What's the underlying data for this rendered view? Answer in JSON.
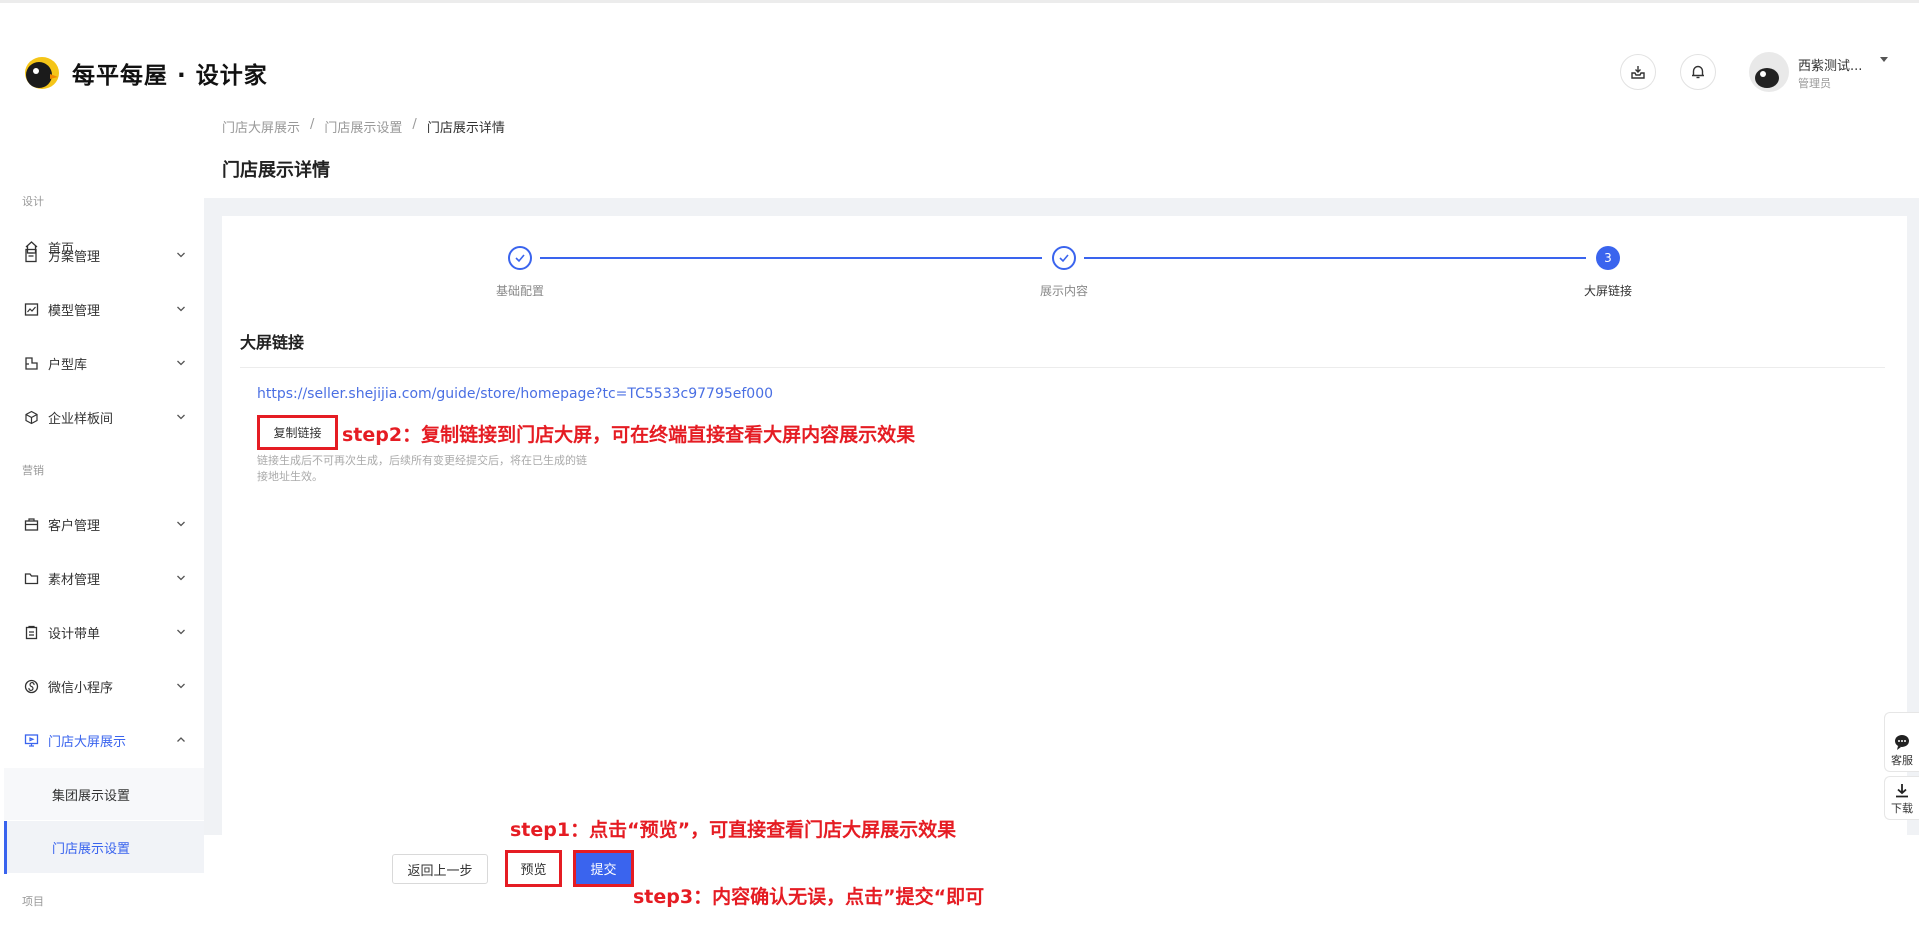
{
  "brand": {
    "name": "每平每屋 · 设计家"
  },
  "header": {
    "user_name": "西紫测试...",
    "user_role": "管理员"
  },
  "sidebar": {
    "home": "首页",
    "group_design": "设计",
    "items_design": [
      {
        "label": "方案管理"
      },
      {
        "label": "模型管理"
      },
      {
        "label": "户型库"
      },
      {
        "label": "企业样板间"
      }
    ],
    "group_marketing": "营销",
    "items_marketing": [
      {
        "label": "客户管理"
      },
      {
        "label": "素材管理"
      },
      {
        "label": "设计带单"
      },
      {
        "label": "微信小程序"
      },
      {
        "label": "门店大屏展示"
      }
    ],
    "sub_items": [
      {
        "label": "集团展示设置"
      },
      {
        "label": "门店展示设置"
      }
    ],
    "group_project": "项目"
  },
  "breadcrumb": [
    "门店大屏展示",
    "门店展示设置",
    "门店展示详情"
  ],
  "page_title": "门店展示详情",
  "steps": [
    {
      "label": "基础配置",
      "state": "done"
    },
    {
      "label": "展示内容",
      "state": "done"
    },
    {
      "number": "3",
      "label": "大屏链接",
      "state": "current"
    }
  ],
  "section": {
    "title": "大屏链接",
    "url": "https://seller.shejijia.com/guide/store/homepage?tc=TC5533c97795ef000",
    "copy_label": "复制链接",
    "hint": "链接生成后不可再次生成，后续所有变更经提交后，将在已生成的链接地址生效。"
  },
  "annotations": {
    "step1": "step1：点击“预览”，可直接查看门店大屏展示效果",
    "step2": "step2：复制链接到门店大屏，可在终端直接查看大屏内容展示效果",
    "step3": "step3：内容确认无误，点击”提交“即可"
  },
  "footer": {
    "back_label": "返回上一步",
    "preview_label": "预览",
    "submit_label": "提交"
  },
  "float_tools": {
    "service_label": "客服",
    "download_label": "下载"
  },
  "colors": {
    "accent": "#3a64ee",
    "annotation": "#e51c23"
  }
}
